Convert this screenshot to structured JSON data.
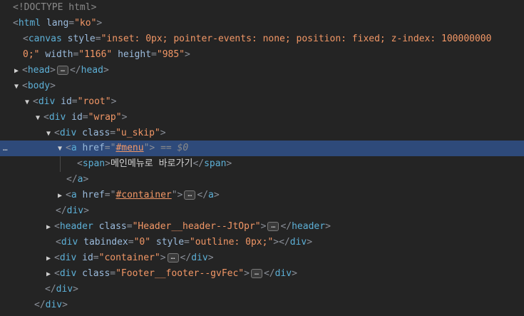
{
  "lines": {
    "doctype": "<!DOCTYPE html>",
    "html_lang_attr": "lang",
    "html_lang_val": "\"ko\"",
    "canvas_style_attr": "style",
    "canvas_style_val_1": "\"inset: 0px; pointer-events: none; position: fixed; z-index: 100000000",
    "canvas_style_val_2": "0;\"",
    "canvas_width_attr": "width",
    "canvas_width_val": "\"1166\"",
    "canvas_height_attr": "height",
    "canvas_height_val": "\"985\"",
    "root_id_attr": "id",
    "root_id_val": "\"root\"",
    "wrap_id_attr": "id",
    "wrap_id_val": "\"wrap\"",
    "skip_class_attr": "class",
    "skip_class_val": "\"u_skip\"",
    "a_menu_href_attr": "href",
    "a_menu_href_val": "#menu",
    "selected_marker": "== $0",
    "span_text": "메인메뉴로 바로가기",
    "a_container_href_attr": "href",
    "a_container_href_val": "#container",
    "header_class_attr": "class",
    "header_class_val": "\"Header__header--JtOpr\"",
    "div_tabindex_attr": "tabindex",
    "div_tabindex_val": "\"0\"",
    "div_style_attr": "style",
    "div_style_val": "\"outline: 0px;\"",
    "container_id_attr": "id",
    "container_id_val": "\"container\"",
    "footer_class_attr": "class",
    "footer_class_val": "\"Footer__footer--gvFec\""
  },
  "tags": {
    "html": "html",
    "canvas": "canvas",
    "head": "head",
    "body": "body",
    "div": "div",
    "a": "a",
    "span": "span",
    "header": "header"
  },
  "dots_label": "…",
  "ellipsis_label": "…"
}
